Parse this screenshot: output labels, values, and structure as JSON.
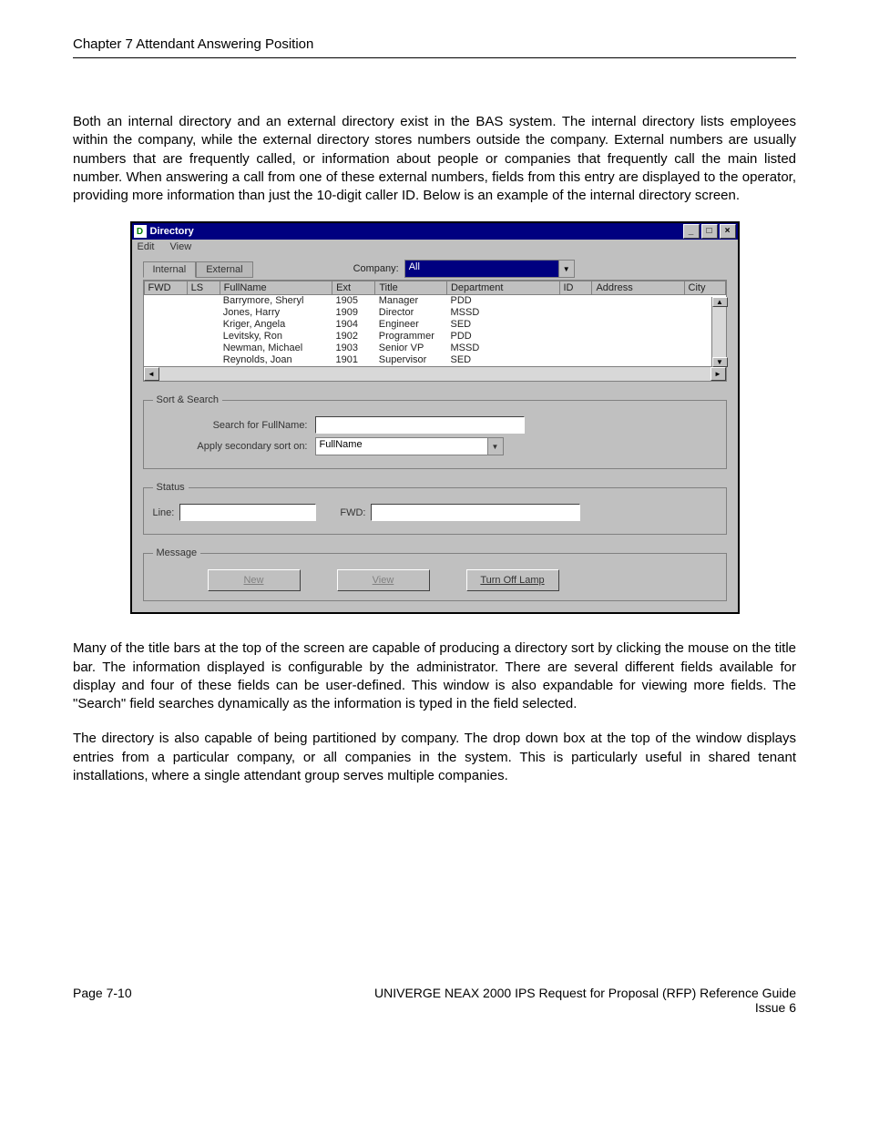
{
  "header": {
    "chapter": "Chapter 7    Attendant Answering Position"
  },
  "paragraphs": {
    "p1": "Both an internal directory and an external directory exist in the BAS system.  The internal directory lists employees within the company, while the external directory stores numbers outside the company.  External numbers are usually numbers that are frequently called, or information about people or companies that frequently call the main listed number.  When answering a call from one of these external numbers, fields from this entry are displayed to the operator, providing more information than just the 10-digit caller ID.  Below is an example of the internal directory screen.",
    "p2": "Many of the title bars at the top of the screen are capable of producing a directory sort by clicking the mouse on the title bar.  The information displayed is configurable by the administrator.  There are several different fields available for display and four of these fields can be user-defined.  This window is also expandable for viewing more fields.  The \"Search\" field searches dynamically as the information is typed in the field selected.",
    "p3": "The directory is also capable of being partitioned by company.   The drop down box at the top of the window displays entries from a particular company, or all companies in the system.  This is particularly useful in shared tenant installations, where a single attendant group serves multiple companies."
  },
  "window": {
    "title": "Directory",
    "menu": {
      "edit": "Edit",
      "view": "View"
    },
    "tabs": {
      "internal": "Internal",
      "external": "External"
    },
    "company_label": "Company:",
    "company_value": "All",
    "columns": [
      "FWD",
      "LS",
      "FullName",
      "Ext",
      "Title",
      "Department",
      "ID",
      "Address",
      "City"
    ],
    "rows": [
      {
        "fullname": "Barrymore, Sheryl",
        "ext": "1905",
        "title": "Manager",
        "dept": "PDD"
      },
      {
        "fullname": "Jones, Harry",
        "ext": "1909",
        "title": "Director",
        "dept": "MSSD"
      },
      {
        "fullname": "Kriger, Angela",
        "ext": "1904",
        "title": "Engineer",
        "dept": "SED"
      },
      {
        "fullname": "Levitsky, Ron",
        "ext": "1902",
        "title": "Programmer",
        "dept": "PDD"
      },
      {
        "fullname": "Newman, Michael",
        "ext": "1903",
        "title": "Senior VP",
        "dept": "MSSD"
      },
      {
        "fullname": "Reynolds, Joan",
        "ext": "1901",
        "title": "Supervisor",
        "dept": "SED"
      }
    ],
    "sort_search": {
      "legend": "Sort & Search",
      "search_label": "Search for FullName:",
      "secondary_label": "Apply secondary sort on:",
      "secondary_value": "FullName"
    },
    "status": {
      "legend": "Status",
      "line_label": "Line:",
      "fwd_label": "FWD:"
    },
    "message": {
      "legend": "Message",
      "new_btn": "New",
      "view_btn": "View",
      "lamp_btn": "Turn Off Lamp"
    }
  },
  "footer": {
    "page": "Page 7-10",
    "title": "UNIVERGE NEAX 2000 IPS Request for Proposal (RFP) Reference Guide",
    "issue": "Issue 6"
  }
}
